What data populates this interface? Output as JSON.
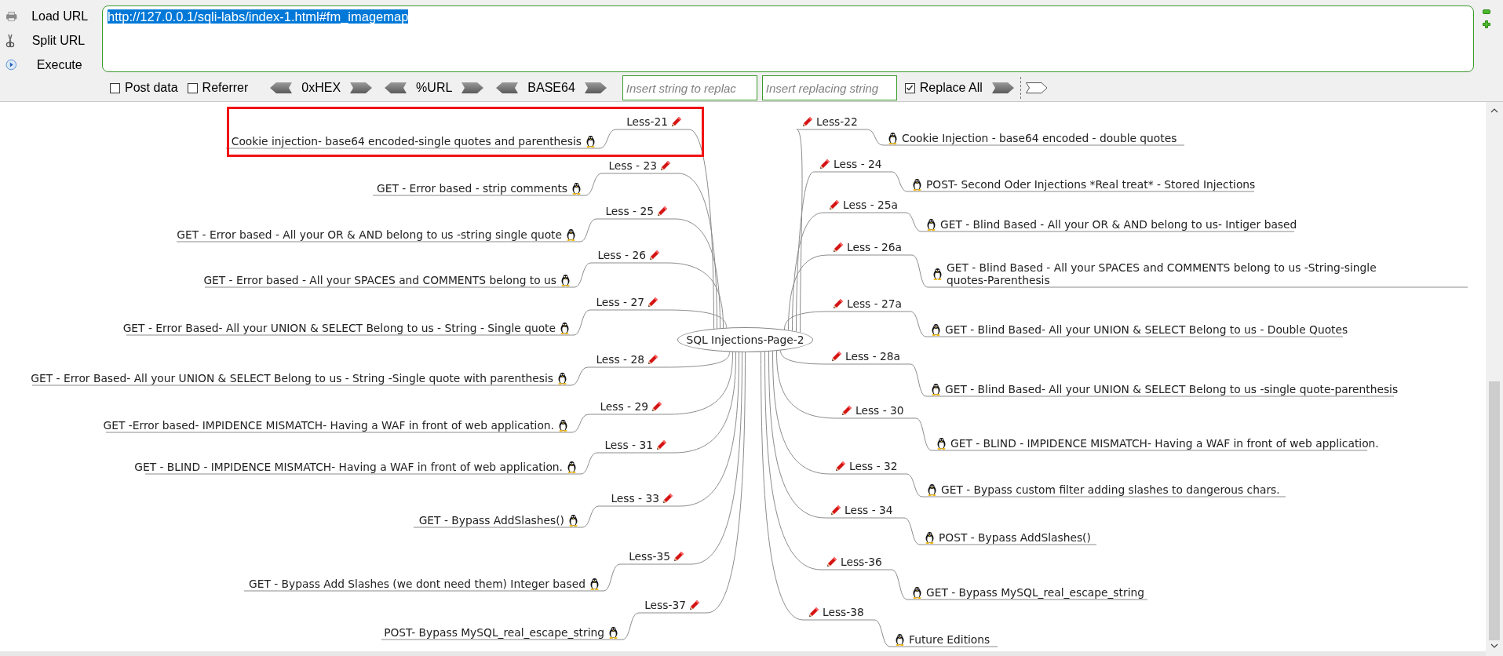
{
  "toolbar": {
    "buttons": [
      {
        "label": "Load URL",
        "kind": "load"
      },
      {
        "label": "Split URL",
        "kind": "split"
      },
      {
        "label": "Execute",
        "kind": "execute"
      }
    ],
    "url": {
      "value": "http://127.0.0.1/sqli-labs/index-1.html#fm_imagemap",
      "selected": true
    },
    "options": [
      {
        "label": "Post data",
        "checked": false
      },
      {
        "label": "Referrer",
        "checked": false
      }
    ],
    "encoders": [
      "0xHEX",
      "%URL",
      "BASE64"
    ],
    "find_placeholder": "Insert string to replac",
    "replace_placeholder": "Insert replacing string",
    "replace_all": {
      "label": "Replace All",
      "checked": true
    }
  },
  "mindmap": {
    "center": "SQL Injections-Page-2",
    "left": [
      {
        "label": "Less-21",
        "text": "Cookie injection- base64 encoded-single quotes and parenthesis",
        "highlighted": true
      },
      {
        "label": "Less - 23",
        "text": "GET - Error based - strip comments",
        "highlighted": false
      },
      {
        "label": "Less - 25",
        "text": "GET - Error based - All your OR & AND belong to us -string single quote",
        "highlighted": false
      },
      {
        "label": "Less - 26",
        "text": "GET - Error based - All your SPACES and COMMENTS belong to us",
        "highlighted": false
      },
      {
        "label": "Less - 27",
        "text": "GET - Error Based- All your UNION & SELECT Belong to us - String - Single quote",
        "highlighted": false
      },
      {
        "label": "Less - 28",
        "text": "GET - Error Based- All your UNION & SELECT Belong to us - String -Single quote with parenthesis",
        "highlighted": false
      },
      {
        "label": "Less - 29",
        "text": "GET -Error based- IMPIDENCE MISMATCH- Having a WAF in front of web application.",
        "highlighted": false
      },
      {
        "label": "Less - 31",
        "text": "GET - BLIND - IMPIDENCE MISMATCH- Having a WAF in front of web application.",
        "highlighted": false
      },
      {
        "label": "Less - 33",
        "text": "GET - Bypass AddSlashes()",
        "highlighted": false
      },
      {
        "label": "Less-35",
        "text": "GET - Bypass Add Slashes (we dont need them) Integer based",
        "highlighted": false
      },
      {
        "label": "Less-37",
        "text": "POST- Bypass MySQL_real_escape_string",
        "highlighted": false
      }
    ],
    "right": [
      {
        "label": "Less-22",
        "text": "Cookie Injection - base64 encoded - double quotes",
        "highlighted": false
      },
      {
        "label": "Less - 24",
        "text": "POST- Second Oder Injections *Real treat* - Stored Injections",
        "highlighted": false
      },
      {
        "label": "Less - 25a",
        "text": "GET - Blind Based - All your OR & AND belong to us- Intiger based",
        "highlighted": false
      },
      {
        "label": "Less - 26a",
        "text": "GET - Blind Based - All your SPACES and COMMENTS belong to us -String-single quotes-Parenthesis",
        "highlighted": false
      },
      {
        "label": "Less - 27a",
        "text": "GET - Blind Based- All your UNION & SELECT Belong to us - Double Quotes",
        "highlighted": false
      },
      {
        "label": "Less - 28a",
        "text": "GET - Blind Based- All your UNION & SELECT Belong to us -single quote-parenthesis",
        "highlighted": false
      },
      {
        "label": "Less - 30",
        "text": "GET - BLIND - IMPIDENCE MISMATCH- Having a WAF in front of web application.",
        "highlighted": false
      },
      {
        "label": "Less - 32",
        "text": "GET - Bypass custom filter adding slashes to dangerous chars.",
        "highlighted": false
      },
      {
        "label": "Less - 34",
        "text": "POST - Bypass AddSlashes()",
        "highlighted": false
      },
      {
        "label": "Less-36",
        "text": "GET - Bypass MySQL_real_escape_string",
        "highlighted": false
      },
      {
        "label": "Less-38",
        "text": "Future Editions",
        "highlighted": false
      }
    ]
  }
}
